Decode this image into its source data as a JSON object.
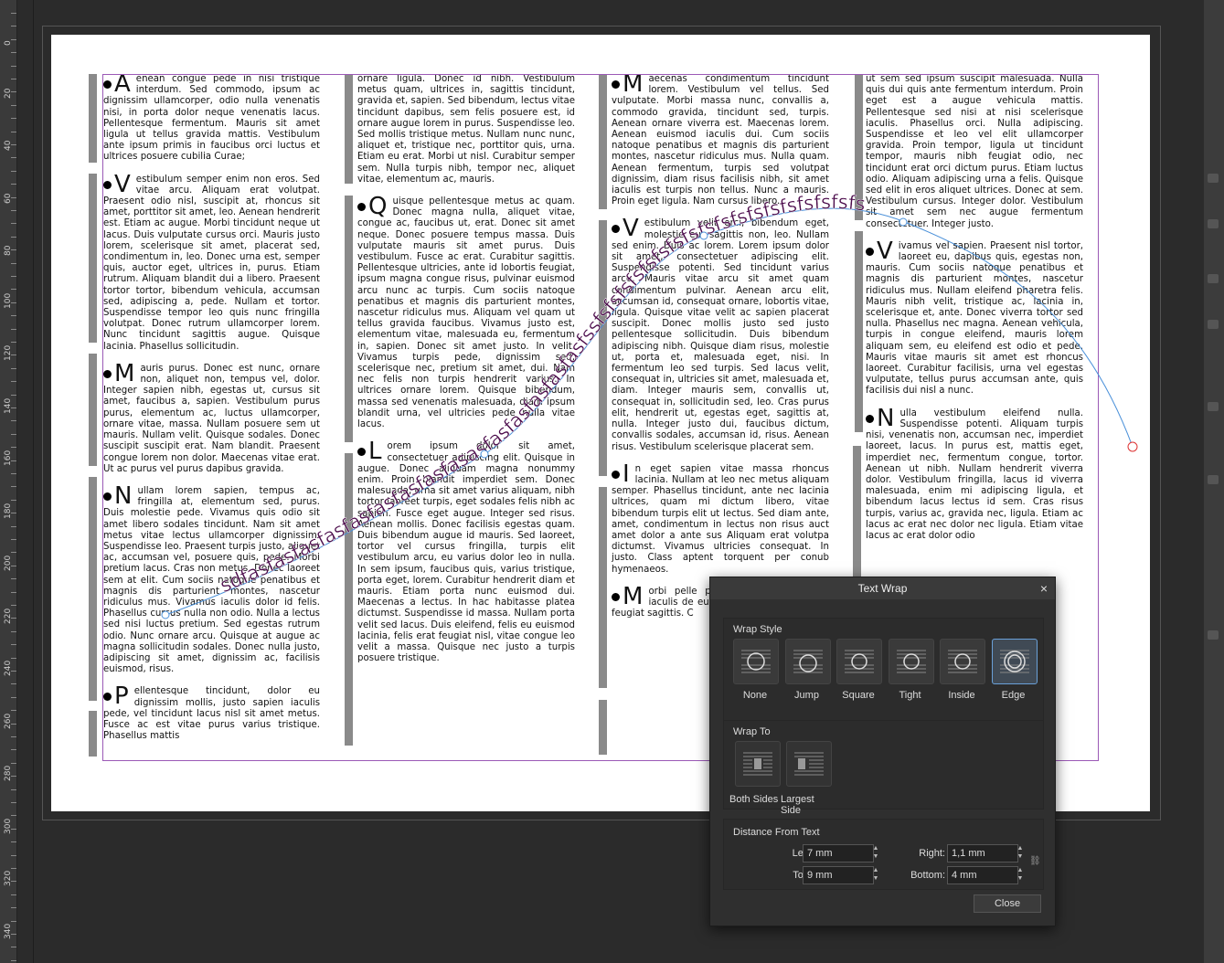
{
  "ruler": {
    "labels": [
      "0",
      "20",
      "40",
      "60",
      "80",
      "100",
      "120",
      "140",
      "160",
      "180",
      "200",
      "220",
      "240",
      "260",
      "280",
      "300",
      "320",
      "340"
    ]
  },
  "document": {
    "columns": [
      {
        "paragraphs": [
          {
            "initial": "A",
            "text": "enean congue pede in nisi tristique interdum. Sed commodo, ipsum ac dignissim ullamcorper, odio nulla venenatis nisi, in porta dolor neque venenatis lacus. Pellentesque fermentum. Mauris sit amet ligula ut tellus gravida mattis. Vestibulum ante ipsum primis in faucibus orci luctus et ultrices posuere cubilia Curae;"
          },
          {
            "initial": "V",
            "text": "estibulum semper enim non eros. Sed vitae arcu. Aliquam erat volutpat. Praesent odio nisl, suscipit at, rhoncus sit amet, porttitor sit amet, leo. Aenean hendrerit est. Etiam ac augue. Morbi tincidunt neque ut lacus. Duis vulputate cursus orci. Mauris justo lorem, scelerisque sit amet, placerat sed, condimentum in, leo. Donec urna est, semper quis, auctor eget, ultrices in, purus. Etiam rutrum. Aliquam blandit dui a libero. Praesent tortor tortor, bibendum vehicula, accumsan sed, adipiscing a, pede. Nullam et tortor. Suspendisse tempor leo quis nunc fringilla volutpat. Donec rutrum ullamcorper lorem. Nunc tincidunt sagittis augue. Quisque lacinia. Phasellus sollicitudin."
          },
          {
            "initial": "M",
            "text": "auris purus. Donec est nunc, ornare non, aliquet non, tempus vel, dolor. Integer sapien nibh, egestas ut, cursus sit amet, faucibus a, sapien. Vestibulum purus purus, elementum ac, luctus ullamcorper, ornare vitae, massa. Nullam posuere sem ut mauris. Nullam velit. Quisque sodales. Donec suscipit suscipit erat. Nam blandit. Praesent congue lorem non dolor. Maecenas vitae erat. Ut ac purus vel purus dapibus gravida."
          },
          {
            "initial": "N",
            "text": "ullam lorem sapien, tempus ac, fringilla at, elementum sed, purus. Duis molestie pede. Vivamus quis odio sit amet libero sodales tincidunt. Nam sit amet metus vitae lectus ullamcorper dignissim. Suspendisse leo. Praesent turpis justo, aliquet ac, accumsan vel, posuere quis, pede. Morbi pretium lacus. Cras non metus. Donec laoreet sem at elit. Cum sociis natoque penatibus et magnis dis parturient montes, nascetur ridiculus mus. Vivamus iaculis dolor id felis. Phasellus cursus nulla non odio. Nulla a lectus sed nisi luctus pretium. Sed egestas rutrum odio. Nunc ornare arcu. Quisque at augue ac magna sollicitudin sodales. Donec nulla justo, adipiscing sit amet, dignissim ac, facilisis euismod, risus."
          },
          {
            "initial": "P",
            "text": "ellentesque tincidunt, dolor eu dignissim mollis, justo sapien iaculis pede, vel tincidunt lacus nisl sit amet metus. Fusce ac est vitae purus varius tristique. Phasellus mattis"
          }
        ]
      },
      {
        "paragraphs": [
          {
            "initial": "",
            "text": "ornare ligula. Donec id nibh. Vestibulum metus quam, ultrices in, sagittis tincidunt, gravida et, sapien. Sed bibendum, lectus vitae tincidunt dapibus, sem felis posuere est, id ornare augue lorem in purus. Suspendisse leo. Sed mollis tristique metus. Nullam nunc nunc, aliquet et, tristique nec, porttitor quis, urna. Etiam eu erat. Morbi ut nisl. Curabitur semper sem. Nulla turpis nibh, tempor nec, aliquet vitae, elementum ac, mauris."
          },
          {
            "initial": "Q",
            "text": "uisque pellentesque metus ac quam. Donec magna nulla, aliquet vitae, congue ac, faucibus ut, erat. Donec sit amet neque. Donec posuere tempus massa. Duis vulputate mauris sit amet purus. Duis vestibulum. Fusce ac erat. Curabitur sagittis. Pellentesque ultricies, ante id lobortis feugiat, ipsum magna congue risus, pulvinar euismod arcu nunc ac turpis. Cum sociis natoque penatibus et magnis dis parturient montes, nascetur ridiculus mus. Aliquam vel quam ut tellus gravida faucibus. Vivamus justo est, elementum vitae, malesuada eu, fermentum in, sapien. Donec sit amet justo. In velit. Vivamus turpis pede, dignissim sed, scelerisque nec, pretium sit amet, dui. Nam nec felis non turpis hendrerit varius. In ultrices ornare lorem. Quisque bibendum, massa sed venenatis malesuada, diam ipsum blandit urna, vel ultricies pede nulla vitae lacus."
          },
          {
            "initial": "L",
            "text": "orem ipsum dolor sit amet, consectetuer adipiscing elit. Quisque in augue. Donec aliquam magna nonummy enim. Proin blandit imperdiet sem. Donec malesuada, urna sit amet varius aliquam, nibh tortor laoreet turpis, eget sodales felis nibh ac sapien. Fusce eget augue. Integer sed risus. Aenean mollis. Donec facilisis egestas quam. Duis bibendum augue id mauris. Sed laoreet, tortor vel cursus fringilla, turpis elit vestibulum arcu, eu varius dolor leo in nulla. In sem ipsum, faucibus quis, varius tristique, porta eget, lorem. Curabitur hendrerit diam et mauris. Etiam porta nunc euismod dui. Maecenas a lectus. In hac habitasse platea dictumst. Suspendisse id massa. Nullam porta velit sed lacus. Duis eleifend, felis eu euismod lacinia, felis erat feugiat nisl, vitae congue leo velit a massa. Quisque nec justo a turpis posuere tristique."
          }
        ]
      },
      {
        "paragraphs": [
          {
            "initial": "M",
            "text": "aecenas condimentum tincidunt lorem. Vestibulum vel tellus. Sed vulputate. Morbi massa nunc, convallis a, commodo gravida, tincidunt sed, turpis. Aenean ornare viverra est. Maecenas lorem. Aenean euismod iaculis dui. Cum sociis natoque penatibus et magnis dis parturient montes, nascetur ridiculus mus. Nulla quam. Aenean fermentum, turpis sed volutpat dignissim, diam risus facilisis nibh, sit amet iaculis est turpis non tellus. Nunc a mauris. Proin eget ligula. Nam cursus libero."
          },
          {
            "initial": "V",
            "text": "estibulum velit orci, bibendum eget, molestie eu, sagittis non, leo. Nullam sed enim. Duis ac lorem. Lorem ipsum dolor sit amet, consectetuer adipiscing elit. Suspendisse potenti. Sed tincidunt varius arcu. Mauris vitae arcu sit amet quam condimentum pulvinar. Aenean arcu elit, accumsan id, consequat ornare, lobortis vitae, ligula. Quisque vitae velit ac sapien placerat suscipit. Donec mollis justo sed justo pellentesque sollicitudin. Duis bibendum adipiscing nibh. Quisque diam risus, molestie ut, porta et, malesuada eget, nisi. In fermentum leo sed turpis. Sed lacus velit, consequat in, ultricies sit amet, malesuada et, diam. Integer mauris sem, convallis ut, consequat in, sollicitudin sed, leo. Cras purus elit, hendrerit ut, egestas eget, sagittis at, nulla. Integer justo dui, faucibus dictum, convallis sodales, accumsan id, risus. Aenean risus. Vestibulum scelerisque placerat sem."
          },
          {
            "initial": "I",
            "text": "n eget sapien vitae massa rhoncus lacinia. Nullam at leo nec metus aliquam semper. Phasellus tincidunt, ante nec lacinia ultrices, quam mi dictum libero, vitae bibendum turpis elit ut lectus. Sed diam ante, amet, condimentum in lectus non risus auct amet dolor a ante sus Aliquam erat volutpa dictumst. Vivamus ultricies consequat. In justo. Class aptent torquent per conub hymenaeos."
          },
          {
            "initial": "M",
            "text": "orbi pelle porta tinc mauris, vitae iaculis de eu diam a leo porta in odio feugiat sagittis. C"
          }
        ]
      },
      {
        "paragraphs": [
          {
            "initial": "",
            "text": "ut sem sed ipsum suscipit malesuada. Nulla quis dui quis ante fermentum interdum. Proin eget est a augue vehicula mattis. Pellentesque sed nisi at nisi scelerisque iaculis. Phasellus orci. Nulla adipiscing. Suspendisse et leo vel elit ullamcorper gravida. Proin tempor, ligula ut tincidunt tempor, mauris nibh feugiat odio, nec tincidunt erat orci dictum purus. Etiam luctus odio. Aliquam adipiscing urna a felis. Quisque sed elit in eros aliquet ultrices. Donec at sem. Vestibulum cursus. Integer dolor. Vestibulum sit amet sem nec augue fermentum consectetuer. Integer justo."
          },
          {
            "initial": "V",
            "text": "ivamus vel sapien. Praesent nisl tortor, laoreet eu, dapibus quis, egestas non, mauris. Cum sociis natoque penatibus et magnis dis parturient montes, nascetur ridiculus mus. Nullam eleifend pharetra felis. Mauris nibh velit, tristique ac, lacinia in, scelerisque et, ante. Donec viverra tortor sed nulla. Phasellus nec magna. Aenean vehicula, turpis in congue eleifend, mauris lorem aliquam sem, eu eleifend est odio et pede. Mauris vitae mauris sit amet est rhoncus laoreet. Curabitur facilisis, urna vel egestas vulputate, tellus purus accumsan ante, quis facilisis dui nisl a nunc."
          },
          {
            "initial": "N",
            "text": "ulla vestibulum eleifend nulla. Suspendisse potenti. Aliquam turpis nisi, venenatis non, accumsan nec, imperdiet laoreet, lacus. In purus est, mattis eget, imperdiet nec, fermentum congue, tortor. Aenean ut nibh. Nullam hendrerit viverra dolor. Vestibulum fringilla, lacus id viverra malesuada, enim mi adipiscing ligula, et bibendum lacus lectus id sem. Cras risus turpis, varius ac, gravida nec, ligula. Etiam ac lacus ac erat nec dolor nec ligula. Etiam vitae lacus ac erat dolor odio"
          }
        ]
      }
    ],
    "path_text": "sdfasfasfasfasfasfasfasfasfasasfasfasfasfasfasfssfsfsfsfsfsfsfsfsfsfsfsfsfsfsfsfsfsfs"
  },
  "dialog": {
    "title": "Text Wrap",
    "close_icon": "×",
    "wrap_style_label": "Wrap Style",
    "wrap_styles": [
      "None",
      "Jump",
      "Square",
      "Tight",
      "Inside",
      "Edge"
    ],
    "selected_style": "Edge",
    "wrap_to_label": "Wrap To",
    "wrap_to": [
      "Both Sides",
      "Largest Side"
    ],
    "distance_label": "Distance From Text",
    "left_label": "Left:",
    "left_value": "7 mm",
    "top_label": "Top:",
    "top_value": "9 mm",
    "right_label": "Right:",
    "right_value": "1,1 mm",
    "bottom_label": "Bottom:",
    "bottom_value": "4 mm",
    "close_button": "Close"
  },
  "colors": {
    "path_text": "#4a0a4a",
    "frame": "#9b59b6",
    "selected": "#6aa0d8",
    "curve": "#4a90d9"
  }
}
